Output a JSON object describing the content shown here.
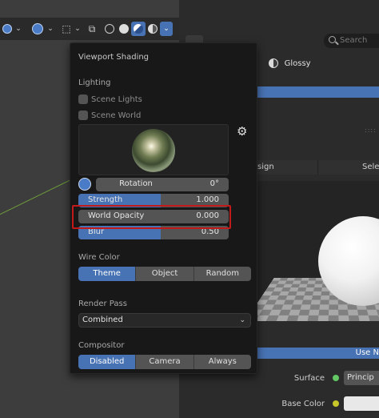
{
  "popover": {
    "title": "Viewport Shading",
    "lighting": {
      "heading": "Lighting",
      "scene_lights": "Scene Lights",
      "scene_world": "Scene World",
      "hdri_icon": "hdri-sphere-preview",
      "gear_icon": "gear-icon"
    },
    "sliders": {
      "rotation": {
        "label": "Rotation",
        "value": "0°"
      },
      "strength": {
        "label": "Strength",
        "value": "1.000",
        "fill": 0.55
      },
      "world_opacity": {
        "label": "World Opacity",
        "value": "0.000"
      },
      "blur": {
        "label": "Blur",
        "value": "0.50",
        "fill": 0.55
      }
    },
    "wire_color": {
      "heading": "Wire Color",
      "options": [
        "Theme",
        "Object",
        "Random"
      ],
      "selected": "Theme"
    },
    "render_pass": {
      "heading": "Render Pass",
      "selected": "Combined"
    },
    "compositor": {
      "heading": "Compositor",
      "options": [
        "Disabled",
        "Camera",
        "Always"
      ],
      "selected": "Disabled"
    }
  },
  "right": {
    "search_placeholder": "Search",
    "material_name": "Glossy",
    "tabs": [
      "sign",
      "Sele"
    ],
    "use_nodes_button": "Use N",
    "surface": {
      "label": "Surface",
      "value": "Princip"
    },
    "base_color": {
      "label": "Base Color"
    }
  },
  "colors": {
    "accent": "#4772b3",
    "highlight": "#c21a1a",
    "background": "#181818"
  }
}
